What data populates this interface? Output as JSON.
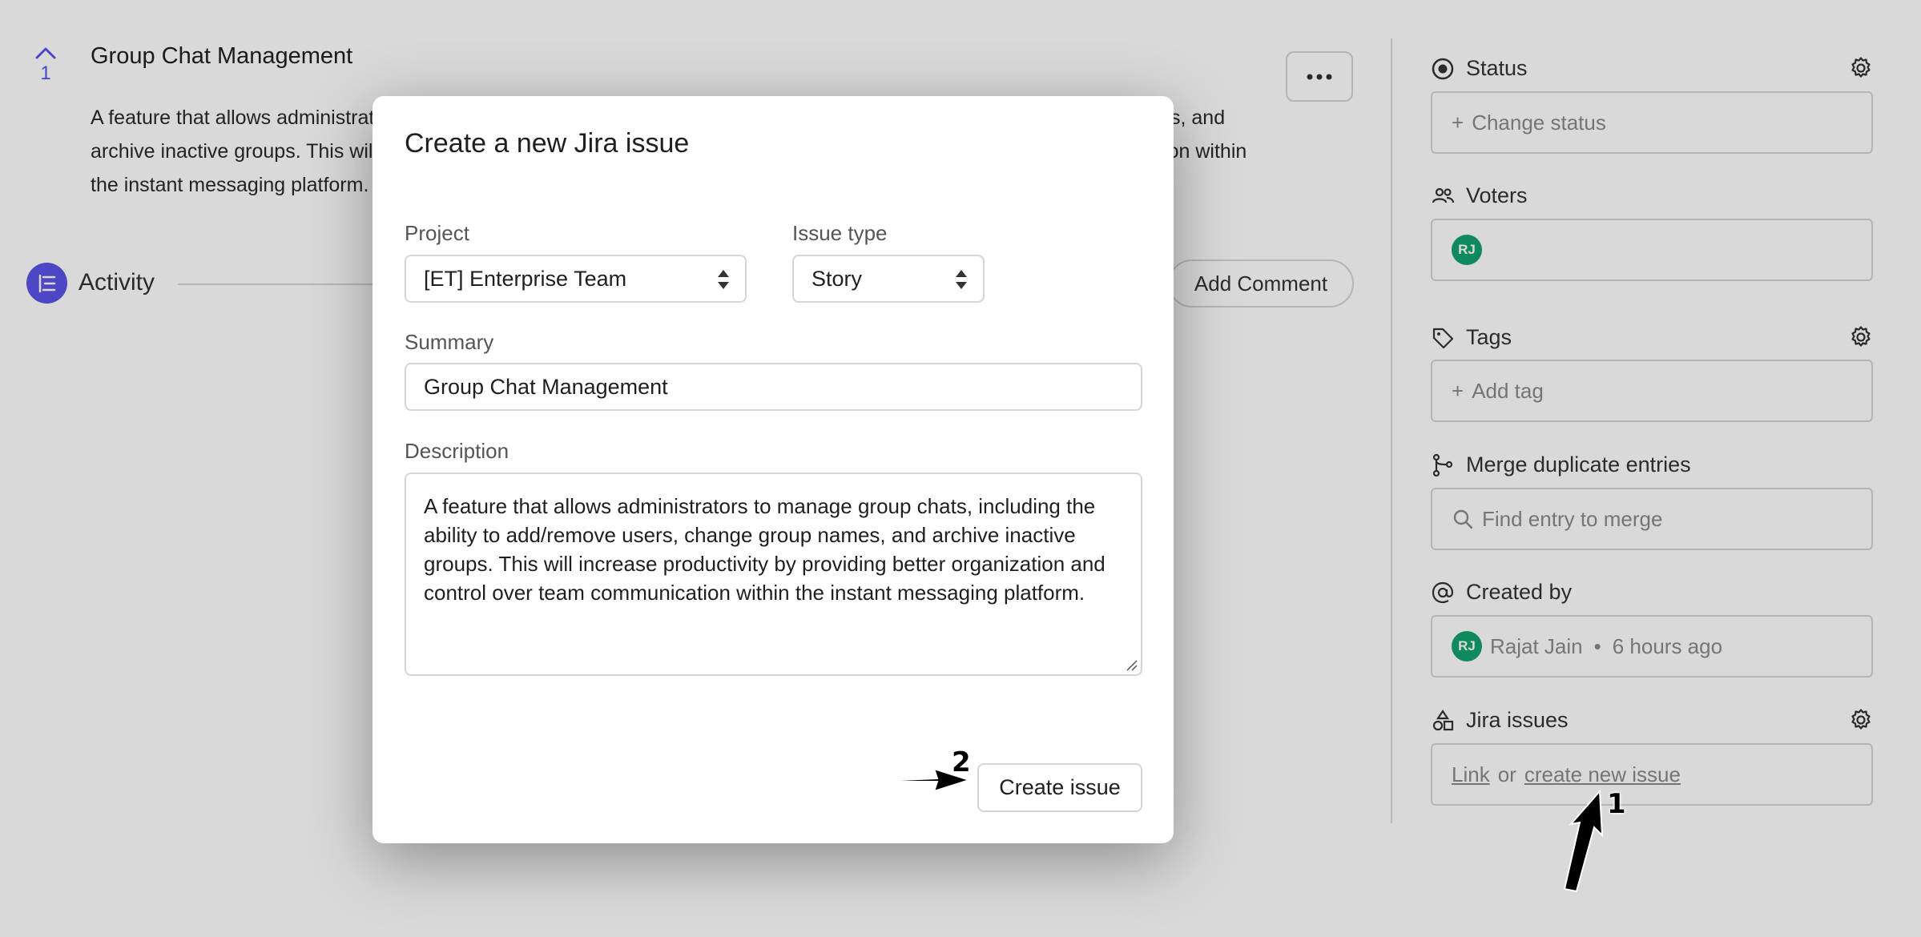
{
  "post": {
    "vote_count": "1",
    "title": "Group Chat Management",
    "body": "A feature that allows administrators to manage group chats, including the ability to add/remove users, change group names, and archive inactive groups. This will increase productivity by providing better organization and control over team communication within the instant messaging platform."
  },
  "activity": {
    "label": "Activity",
    "add_comment_label": "Add Comment"
  },
  "sidebar": {
    "status": {
      "label": "Status",
      "placeholder": "Change status"
    },
    "voters": {
      "label": "Voters",
      "avatar_initials": "RJ"
    },
    "tags": {
      "label": "Tags",
      "placeholder": "Add tag"
    },
    "merge": {
      "label": "Merge duplicate entries",
      "placeholder": "Find entry to merge"
    },
    "created_by": {
      "label": "Created by",
      "avatar_initials": "RJ",
      "name": "Rajat Jain",
      "separator": "•",
      "time": "6 hours ago"
    },
    "jira": {
      "label": "Jira issues",
      "link_label": "Link",
      "or_label": "or",
      "create_label": "create new issue"
    }
  },
  "modal": {
    "title": "Create a new Jira issue",
    "project_label": "Project",
    "project_value": "[ET] Enterprise Team",
    "issue_type_label": "Issue type",
    "issue_type_value": "Story",
    "summary_label": "Summary",
    "summary_value": "Group Chat Management",
    "description_label": "Description",
    "description_value": "A feature that allows administrators to manage group chats, including the ability to add/remove users, change group names, and archive inactive groups. This will increase productivity by providing better organization and control over team communication within the instant messaging platform.",
    "create_button_label": "Create issue"
  },
  "annotations": {
    "step1": "1",
    "step2": "2"
  },
  "colors": {
    "accent": "#5b53e8",
    "avatar": "#12a36f",
    "overlay": "rgba(0,0,0,0.15)"
  }
}
